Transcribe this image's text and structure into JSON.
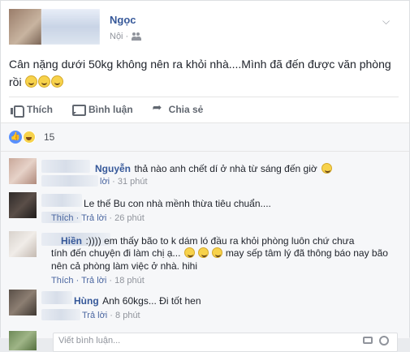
{
  "post": {
    "author": "Ngọc",
    "location_time": "Nội ·",
    "text": "Cân nặng dưới 50kg không nên ra khỏi nhà....Mình đã đến được văn phòng rồi",
    "emojis": [
      "laugh-emoji",
      "laugh-emoji",
      "laugh-emoji"
    ]
  },
  "actions": {
    "like": "Thích",
    "comment": "Bình luận",
    "share": "Chia sẻ"
  },
  "reactions": {
    "count": "15",
    "icons": [
      "like-reaction-icon",
      "haha-reaction-icon"
    ]
  },
  "comments": [
    {
      "name": "Nguyễn",
      "text": "thả nào anh chết dí ở nhà từ sáng đến giờ",
      "meta_link": "lời",
      "time": "31 phút"
    },
    {
      "name": "",
      "text": "Le thế Bu con nhà mềnh thừa tiêu chuẩn....",
      "meta_link": "Thích · Trả lời",
      "time": "26 phút"
    },
    {
      "name": "Hiền",
      "text_line1": ":)))) em thấy bão to k dám ló đầu ra khỏi phòng luôn chứ chưa",
      "text_line2": "tính đến chuyện đi làm chị ạ...",
      "text_line2b": "may sếp tâm lý đã thông báo nay bão",
      "text_line3": "nên cả phòng làm việc ở nhà. hihi",
      "meta_link": "Thích · Trả lời",
      "time": "18 phút"
    },
    {
      "name": "Hùng",
      "text": "Anh 60kgs... Đi tốt hen",
      "meta_link": "Trả lời",
      "time": "8 phút"
    }
  ],
  "write_comment": {
    "placeholder": "Viết bình luận..."
  }
}
